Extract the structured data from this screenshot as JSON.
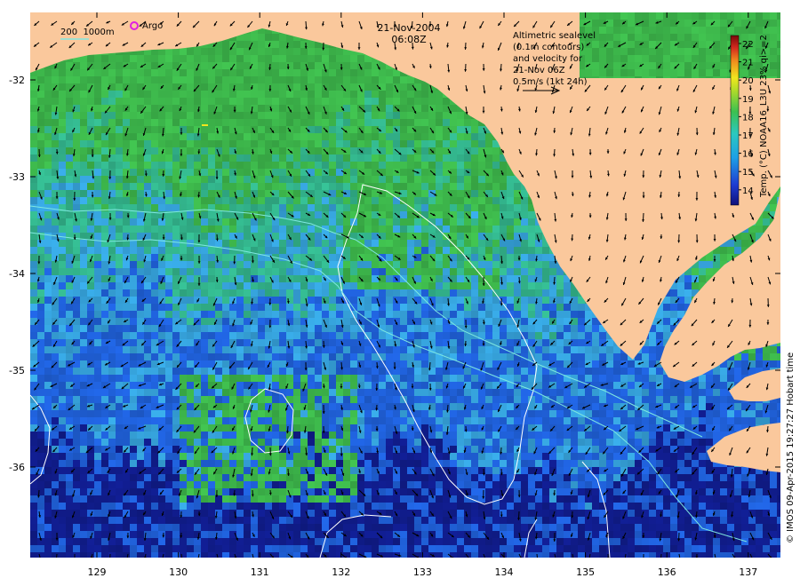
{
  "map": {
    "date": "21-Nov-2004",
    "time": "06:08Z",
    "info_lines": [
      "Altimetric sealevel",
      "(0.1m contours)",
      "and velocity for",
      "21-Nov 06Z",
      "0.5m/s (1kt 24h)"
    ],
    "bathy_legend": "200  1000m",
    "argo_label": "Argo",
    "colorbar_title": "Temp. (°C) NOAA16_L3U 23% qi>=2",
    "colorbar_ticks": [
      "22",
      "21",
      "20",
      "19",
      "18",
      "17",
      "16",
      "15",
      "14"
    ],
    "credit": "© IMOS 09-Apr-2015 19:27:27 Hobart time",
    "lat_ticks": [
      "-32",
      "-33",
      "-34",
      "-35",
      "-36"
    ],
    "lon_ticks": [
      "129",
      "130",
      "131",
      "132",
      "133",
      "134",
      "135",
      "136",
      "137"
    ],
    "colors": {
      "land": "#fac89c",
      "green": "#3cb44a",
      "teal": "#32b28a",
      "lightblue": "#35a0d8",
      "blue": "#1f5fd6",
      "darkblue": "#101c8a",
      "arrow": "#000000",
      "contour": "#ffffff",
      "bathy": "#7fe7e0",
      "argo": "#e020e0"
    }
  }
}
